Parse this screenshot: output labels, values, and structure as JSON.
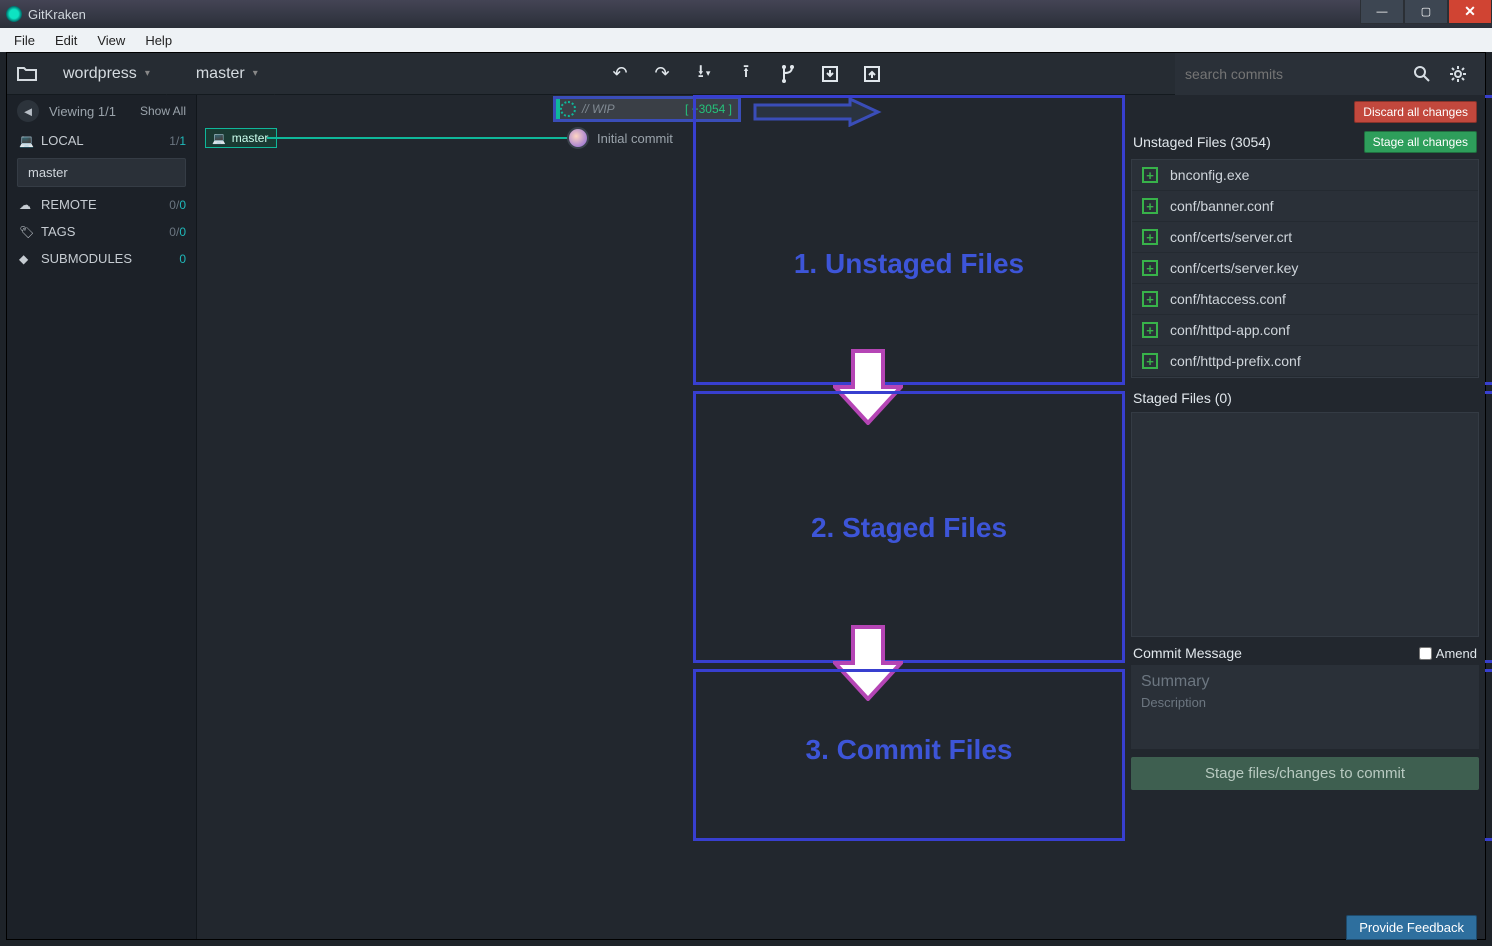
{
  "window": {
    "title": "GitKraken"
  },
  "menu": [
    "File",
    "Edit",
    "View",
    "Help"
  ],
  "toolbar": {
    "repo": "wordpress",
    "branch": "master",
    "search_placeholder": "search commits"
  },
  "sidebar": {
    "viewing": "Viewing 1/1",
    "showall": "Show All",
    "sections": {
      "local": {
        "label": "LOCAL",
        "count": "1/",
        "count2": "1"
      },
      "remote": {
        "label": "REMOTE",
        "count": "0/",
        "count2": "0"
      },
      "tags": {
        "label": "TAGS",
        "count": "0/",
        "count2": "0"
      },
      "submodules": {
        "label": "SUBMODULES",
        "count": "0"
      }
    },
    "branch": "master"
  },
  "graph": {
    "wip_label": "// WIP",
    "wip_count": "[ +3054 ]",
    "branch_tag": "master",
    "commit_msg": "Initial commit"
  },
  "annotations": {
    "region1": "1. Unstaged Files",
    "region2": "2. Staged Files",
    "region3": "3. Commit Files"
  },
  "right": {
    "discard": "Discard all changes",
    "unstaged_title": "Unstaged Files (3054)",
    "stage_all": "Stage all changes",
    "files": [
      "bnconfig.exe",
      "conf/banner.conf",
      "conf/certs/server.crt",
      "conf/certs/server.key",
      "conf/htaccess.conf",
      "conf/httpd-app.conf",
      "conf/httpd-prefix.conf"
    ],
    "staged_title": "Staged Files (0)",
    "commit_title": "Commit Message",
    "amend": "Amend",
    "summary_ph": "Summary",
    "desc_ph": "Description",
    "commit_btn": "Stage files/changes to commit"
  },
  "feedback": "Provide Feedback"
}
